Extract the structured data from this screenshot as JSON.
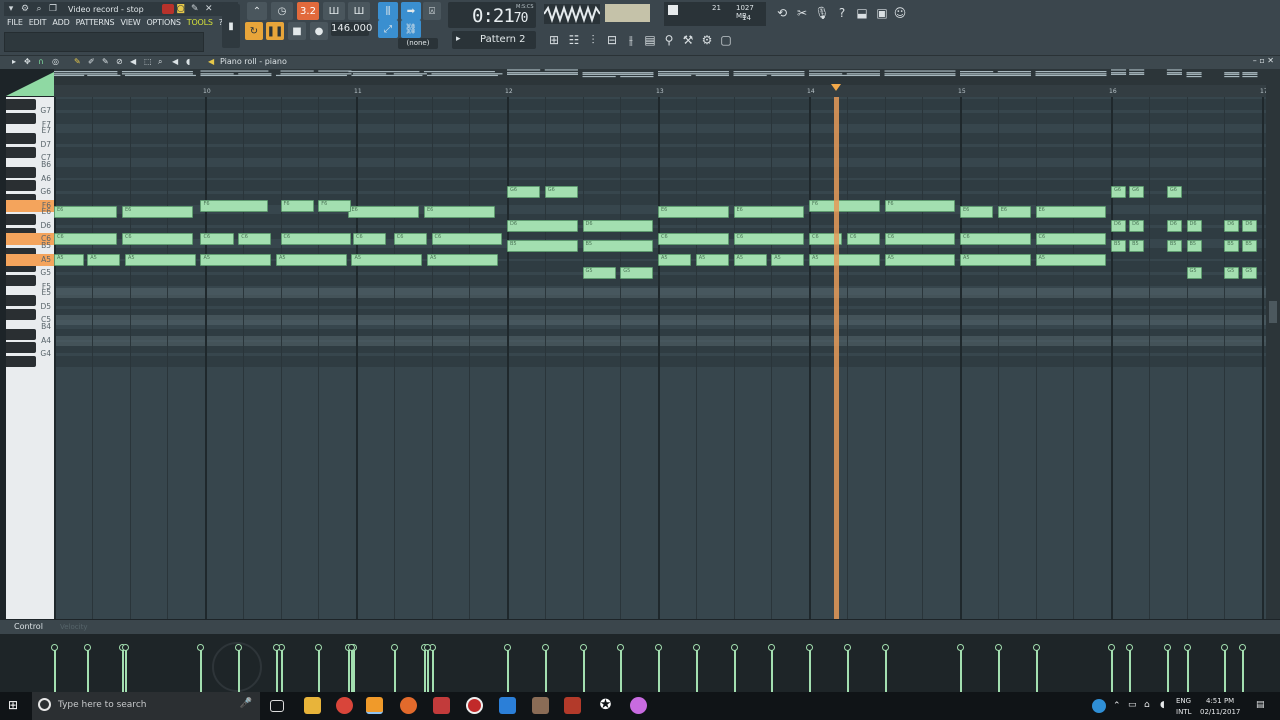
{
  "window": {
    "title": "Video record - stop"
  },
  "menu": [
    {
      "label": "FILE"
    },
    {
      "label": "EDIT"
    },
    {
      "label": "ADD"
    },
    {
      "label": "PATTERNS"
    },
    {
      "label": "VIEW"
    },
    {
      "label": "OPTIONS"
    },
    {
      "label": "TOOLS"
    },
    {
      "label": "?"
    }
  ],
  "transport": {
    "tempo": "146.000",
    "time": "0:21",
    "time_sub": "70",
    "time_unit": "M:S:CS",
    "pattern": "Pattern 2",
    "channel": "(none)",
    "cpu_value": "21",
    "ram_value": "1027 MB",
    "poly_value": "14",
    "pat_song_label": "3.2"
  },
  "piano_roll": {
    "title": "Piano roll - piano",
    "bars": [
      "10",
      "11",
      "12",
      "13",
      "14",
      "15",
      "16",
      "17"
    ],
    "key_labels": [
      "G7",
      "F7",
      "E7",
      "D7",
      "C7",
      "B6",
      "A6",
      "G6",
      "F6",
      "E6",
      "D6",
      "C6",
      "B5",
      "A5",
      "G5",
      "F5",
      "E5",
      "D5",
      "C5",
      "B4",
      "A4",
      "G4"
    ],
    "highlighted_keys": [
      "F6",
      "C6",
      "A5"
    ],
    "playhead_bar": 14.18,
    "notes": [
      {
        "pitch": "E6",
        "start": 9.0,
        "len": 0.42
      },
      {
        "pitch": "E6",
        "start": 9.45,
        "len": 0.47
      },
      {
        "pitch": "E6",
        "start": 10.95,
        "len": 0.47
      },
      {
        "pitch": "E6",
        "start": 11.45,
        "len": 0.47
      },
      {
        "pitch": "E6",
        "start": 13.0,
        "len": 0.47
      },
      {
        "pitch": "E6",
        "start": 13.5,
        "len": 0.47
      },
      {
        "pitch": "E6",
        "start": 15.0,
        "len": 0.22
      },
      {
        "pitch": "E6",
        "start": 15.25,
        "len": 0.22
      },
      {
        "pitch": "E6",
        "start": 15.5,
        "len": 0.47
      },
      {
        "pitch": "F6",
        "start": 9.97,
        "len": 0.45
      },
      {
        "pitch": "F6",
        "start": 10.5,
        "len": 0.22
      },
      {
        "pitch": "F6",
        "start": 10.75,
        "len": 0.22
      },
      {
        "pitch": "F6",
        "start": 14.0,
        "len": 0.47
      },
      {
        "pitch": "F6",
        "start": 14.5,
        "len": 0.47
      },
      {
        "pitch": "G6",
        "start": 12.0,
        "len": 0.22
      },
      {
        "pitch": "G6",
        "start": 12.25,
        "len": 0.22
      },
      {
        "pitch": "G6",
        "start": 16.0,
        "len": 0.1
      },
      {
        "pitch": "G6",
        "start": 16.12,
        "len": 0.1
      },
      {
        "pitch": "G6",
        "start": 16.37,
        "len": 0.1
      },
      {
        "pitch": "D6",
        "start": 12.0,
        "len": 0.47
      },
      {
        "pitch": "D6",
        "start": 12.5,
        "len": 0.47
      },
      {
        "pitch": "D6",
        "start": 16.0,
        "len": 0.1
      },
      {
        "pitch": "D6",
        "start": 16.12,
        "len": 0.1
      },
      {
        "pitch": "D6",
        "start": 16.37,
        "len": 0.1
      },
      {
        "pitch": "D6",
        "start": 16.5,
        "len": 0.1
      },
      {
        "pitch": "D6",
        "start": 16.75,
        "len": 0.1
      },
      {
        "pitch": "D6",
        "start": 16.87,
        "len": 0.1
      },
      {
        "pitch": "C6",
        "start": 9.0,
        "len": 0.42
      },
      {
        "pitch": "C6",
        "start": 9.45,
        "len": 0.47
      },
      {
        "pitch": "C6",
        "start": 9.97,
        "len": 0.22
      },
      {
        "pitch": "C6",
        "start": 10.22,
        "len": 0.22
      },
      {
        "pitch": "C6",
        "start": 10.5,
        "len": 0.47
      },
      {
        "pitch": "C6",
        "start": 10.98,
        "len": 0.22
      },
      {
        "pitch": "C6",
        "start": 11.25,
        "len": 0.22
      },
      {
        "pitch": "C6",
        "start": 11.5,
        "len": 0.47
      },
      {
        "pitch": "C6",
        "start": 13.0,
        "len": 0.47
      },
      {
        "pitch": "C6",
        "start": 13.5,
        "len": 0.47
      },
      {
        "pitch": "C6",
        "start": 14.0,
        "len": 0.22
      },
      {
        "pitch": "C6",
        "start": 14.25,
        "len": 0.22
      },
      {
        "pitch": "C6",
        "start": 14.5,
        "len": 0.47
      },
      {
        "pitch": "C6",
        "start": 15.0,
        "len": 0.47
      },
      {
        "pitch": "C6",
        "start": 15.5,
        "len": 0.47
      },
      {
        "pitch": "B5",
        "start": 12.0,
        "len": 0.47
      },
      {
        "pitch": "B5",
        "start": 12.5,
        "len": 0.47
      },
      {
        "pitch": "B5",
        "start": 16.0,
        "len": 0.1
      },
      {
        "pitch": "B5",
        "start": 16.12,
        "len": 0.1
      },
      {
        "pitch": "B5",
        "start": 16.37,
        "len": 0.1
      },
      {
        "pitch": "B5",
        "start": 16.5,
        "len": 0.1
      },
      {
        "pitch": "B5",
        "start": 16.75,
        "len": 0.1
      },
      {
        "pitch": "B5",
        "start": 16.87,
        "len": 0.1
      },
      {
        "pitch": "A5",
        "start": 9.0,
        "len": 0.2
      },
      {
        "pitch": "A5",
        "start": 9.22,
        "len": 0.22
      },
      {
        "pitch": "A5",
        "start": 9.47,
        "len": 0.47
      },
      {
        "pitch": "A5",
        "start": 9.97,
        "len": 0.47
      },
      {
        "pitch": "A5",
        "start": 10.47,
        "len": 0.47
      },
      {
        "pitch": "A5",
        "start": 10.97,
        "len": 0.47
      },
      {
        "pitch": "A5",
        "start": 11.47,
        "len": 0.47
      },
      {
        "pitch": "A5",
        "start": 13.0,
        "len": 0.22
      },
      {
        "pitch": "A5",
        "start": 13.25,
        "len": 0.22
      },
      {
        "pitch": "A5",
        "start": 13.5,
        "len": 0.22
      },
      {
        "pitch": "A5",
        "start": 13.75,
        "len": 0.22
      },
      {
        "pitch": "A5",
        "start": 14.0,
        "len": 0.47
      },
      {
        "pitch": "A5",
        "start": 14.5,
        "len": 0.47
      },
      {
        "pitch": "A5",
        "start": 15.0,
        "len": 0.47
      },
      {
        "pitch": "A5",
        "start": 15.5,
        "len": 0.47
      },
      {
        "pitch": "G5",
        "start": 12.5,
        "len": 0.22
      },
      {
        "pitch": "G5",
        "start": 12.75,
        "len": 0.22
      },
      {
        "pitch": "G5",
        "start": 16.5,
        "len": 0.1
      },
      {
        "pitch": "G5",
        "start": 16.75,
        "len": 0.1
      },
      {
        "pitch": "G5",
        "start": 16.87,
        "len": 0.1
      }
    ]
  },
  "control": {
    "label": "Control",
    "target": "Velocity"
  },
  "taskbar": {
    "search_placeholder": "Type here to search",
    "lang_top": "ENG",
    "lang_bottom": "INTL",
    "time": "4:51 PM",
    "date": "02/11/2017"
  },
  "colors": {
    "note_fill": "#a3dfb0",
    "note_border": "#5f9b70",
    "playhead": "#e59a58",
    "key_highlight": "#f4a45c",
    "grid_bg": "#37464d",
    "record": "#b8322b"
  }
}
